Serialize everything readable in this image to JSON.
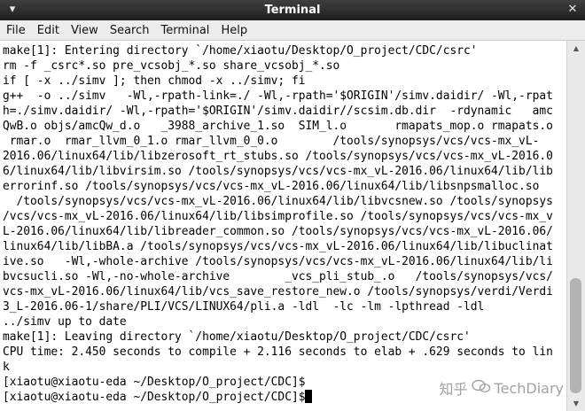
{
  "window": {
    "title": "Terminal"
  },
  "titlebar": {
    "menu_glyph": "▾",
    "close_glyph": "✕"
  },
  "menu": [
    "File",
    "Edit",
    "View",
    "Search",
    "Terminal",
    "Help"
  ],
  "terminal": {
    "lines": [
      "make[1]: Entering directory `/home/xiaotu/Desktop/O_project/CDC/csrc'",
      "rm -f _csrc*.so pre_vcsobj_*.so share_vcsobj_*.so",
      "if [ -x ../simv ]; then chmod -x ../simv; fi",
      "g++  -o ../simv   -Wl,-rpath-link=./ -Wl,-rpath='$ORIGIN'/simv.daidir/ -Wl,-rpat",
      "h=./simv.daidir/ -Wl,-rpath='$ORIGIN'/simv.daidir//scsim.db.dir  -rdynamic   amc",
      "QwB.o objs/amcQw_d.o   _3988_archive_1.so  SIM_l.o       rmapats_mop.o rmapats.o",
      " rmar.o  rmar_llvm_0_1.o rmar_llvm_0_0.o        /tools/synopsys/vcs/vcs-mx_vL-",
      "2016.06/linux64/lib/libzerosoft_rt_stubs.so /tools/synopsys/vcs/vcs-mx_vL-2016.0",
      "6/linux64/lib/libvirsim.so /tools/synopsys/vcs/vcs-mx_vL-2016.06/linux64/lib/lib",
      "errorinf.so /tools/synopsys/vcs/vcs-mx_vL-2016.06/linux64/lib/libsnpsmalloc.so",
      "  /tools/synopsys/vcs/vcs-mx_vL-2016.06/linux64/lib/libvcsnew.so /tools/synopsys",
      "/vcs/vcs-mx_vL-2016.06/linux64/lib/libsimprofile.so /tools/synopsys/vcs/vcs-mx_v",
      "L-2016.06/linux64/lib/libreader_common.so /tools/synopsys/vcs/vcs-mx_vL-2016.06/",
      "linux64/lib/libBA.a /tools/synopsys/vcs/vcs-mx_vL-2016.06/linux64/lib/libuclinat",
      "ive.so   -Wl,-whole-archive /tools/synopsys/vcs/vcs-mx_vL-2016.06/linux64/lib/li",
      "bvcsucli.so -Wl,-no-whole-archive        _vcs_pli_stub_.o   /tools/synopsys/vcs/",
      "vcs-mx_vL-2016.06/linux64/lib/vcs_save_restore_new.o /tools/synopsys/verdi/Verdi",
      "3_L-2016.06-1/share/PLI/VCS/LINUX64/pli.a -ldl  -lc -lm -lpthread -ldl",
      "../simv up to date",
      "make[1]: Leaving directory `/home/xiaotu/Desktop/O_project/CDC/csrc'",
      "CPU time: 2.450 seconds to compile + 2.116 seconds to elab + .629 seconds to lin",
      "k",
      "[xiaotu@xiaotu-eda ~/Desktop/O_project/CDC]$",
      "[xiaotu@xiaotu-eda ~/Desktop/O_project/CDC]$"
    ]
  },
  "scrollbar": {
    "up_glyph": "▲",
    "down_glyph": "▼"
  },
  "watermark": {
    "text_left": "知乎",
    "text_right": "TechDiary",
    "icon": "wechat-icon"
  }
}
